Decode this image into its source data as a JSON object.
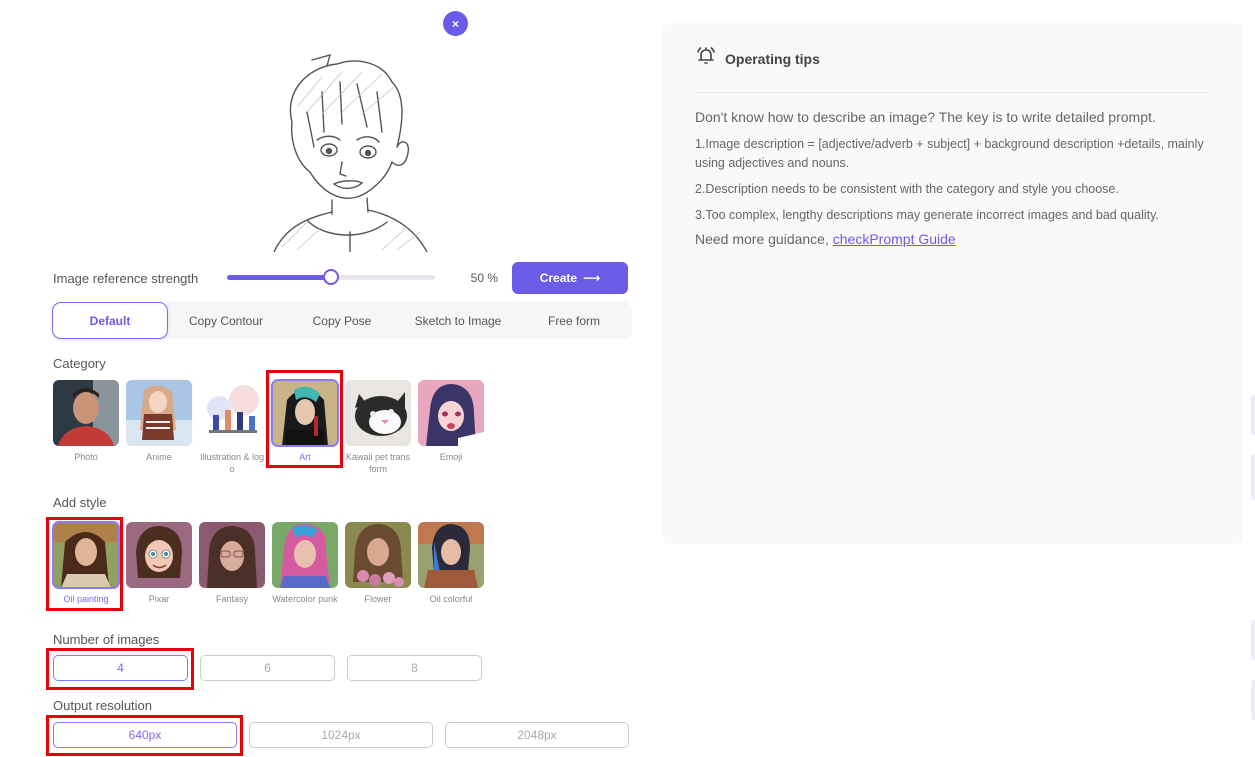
{
  "close_button": {
    "icon": "close-icon",
    "glyph": "×"
  },
  "reference_image": {
    "description": "pencil sketch of anime boy in hoodie"
  },
  "strength": {
    "label": "Image reference strength",
    "value_percent": 50,
    "value_text": "50 %"
  },
  "create_button": {
    "label": "Create",
    "arrow": "⟶"
  },
  "mode_tabs": [
    {
      "label": "Default",
      "active": true
    },
    {
      "label": "Copy Contour",
      "active": false
    },
    {
      "label": "Copy Pose",
      "active": false
    },
    {
      "label": "Sketch to Image",
      "active": false
    },
    {
      "label": "Free form",
      "active": false
    }
  ],
  "category": {
    "label": "Category",
    "items": [
      {
        "label": "Photo",
        "selected": false
      },
      {
        "label": "Anime",
        "selected": false
      },
      {
        "label": "Illustration & logo",
        "selected": false
      },
      {
        "label": "Art",
        "selected": true
      },
      {
        "label": "Kawaii pet transform",
        "selected": false
      },
      {
        "label": "Emoji",
        "selected": false
      }
    ]
  },
  "style": {
    "label": "Add style",
    "items": [
      {
        "label": "Oil painting",
        "selected": true
      },
      {
        "label": "Pixar",
        "selected": false
      },
      {
        "label": "Fantasy",
        "selected": false
      },
      {
        "label": "Watercolor punk",
        "selected": false
      },
      {
        "label": "Flower",
        "selected": false
      },
      {
        "label": "Oil colorful",
        "selected": false
      }
    ]
  },
  "num_images": {
    "label": "Number of images",
    "options": [
      {
        "label": "4",
        "selected": true
      },
      {
        "label": "6",
        "selected": false
      },
      {
        "label": "8",
        "selected": false
      }
    ]
  },
  "resolution": {
    "label": "Output resolution",
    "options": [
      {
        "label": "640px",
        "selected": true
      },
      {
        "label": "1024px",
        "selected": false
      },
      {
        "label": "2048px",
        "selected": false
      }
    ]
  },
  "tips": {
    "icon": "bell-icon",
    "title": "Operating tips",
    "intro": "Don't know how to describe an image? The key is to write detailed prompt.",
    "items": [
      "1.Image description = [adjective/adverb + subject] + background description +details, mainly using adjectives and nouns.",
      "2.Description needs to be consistent with the category and style you choose.",
      "3.Too complex, lengthy descriptions may generate incorrect images and bad quality."
    ],
    "guide_prefix": "Need more guidance, ",
    "guide_link": "checkPrompt Guide"
  },
  "colors": {
    "accent": "#6b5ce7",
    "highlight_box": "#e8000b",
    "tips_bg": "#f9f9fa"
  }
}
